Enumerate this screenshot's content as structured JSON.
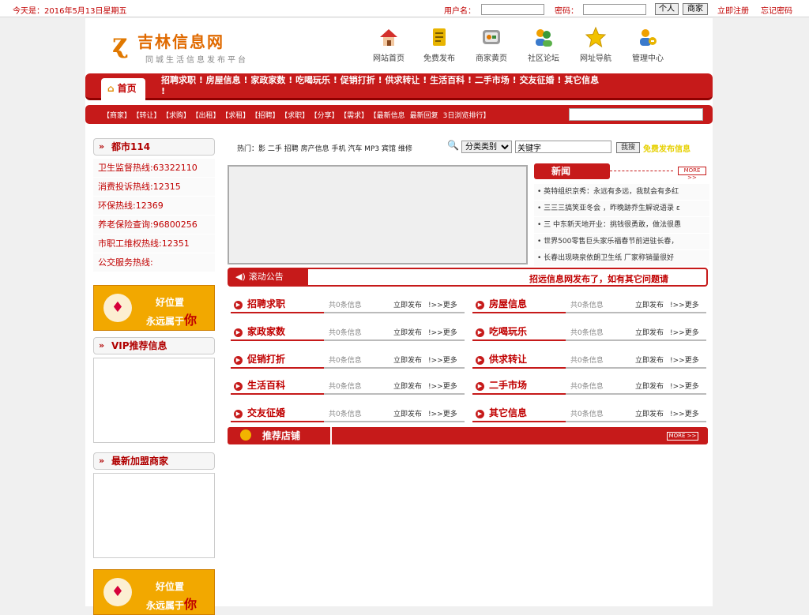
{
  "topbar": {
    "date": "今天是：2016年5月13日星期五",
    "username_label": "用户名：",
    "password_label": "密码：",
    "btn_personal": "个人",
    "btn_merchant": "商家",
    "register_link": "立即注册",
    "forgot_link": "忘记密码"
  },
  "logo": {
    "name": "吉林信息网",
    "tagline": "同城生活信息发布平台"
  },
  "nav_icons": [
    {
      "label": "网站首页",
      "icon": "house-icon"
    },
    {
      "label": "免费发布",
      "icon": "document-icon"
    },
    {
      "label": "商家黄页",
      "icon": "yellowpage-icon"
    },
    {
      "label": "社区论坛",
      "icon": "users-icon"
    },
    {
      "label": "网址导航",
      "icon": "star-icon"
    },
    {
      "label": "管理中心",
      "icon": "admin-icon"
    }
  ],
  "menu": {
    "home": "首页",
    "items": [
      "招聘求职",
      "房屋信息",
      "家政家数",
      "吃喝玩乐",
      "促销打折",
      "供求转让",
      "生活百科",
      "二手市场",
      "交友征婚",
      "其它信息"
    ],
    "trailer": "!"
  },
  "subnav": {
    "links": [
      "【商家】",
      "【转让】",
      "【求购】",
      "【出租】",
      "【求租】",
      "【招聘】",
      "【求职】",
      "【分享】",
      "【需求】",
      "【最新信息",
      "最新回复",
      "3日浏览排行】"
    ]
  },
  "left": {
    "city114_title": "都市114",
    "hotlines": [
      "卫生监督热线:63322110",
      "消费投诉热线:12315",
      "环保热线:12369",
      "养老保险查询:96800256",
      "市职工维权热线:12351",
      "公交服务热线:"
    ],
    "ad_line1": "好位置",
    "ad_line2a": "永远属于",
    "ad_line2b": "你",
    "vip_title": "VIP推荐信息",
    "new_merchants_title": "最新加盟商家"
  },
  "search": {
    "hot_label": "热门：",
    "hot_words": "影 二手 招聘 房产信息 手机 汽车 MP3 宾馆 维修",
    "category_selected": "分类类别",
    "keyword_value": "关键字",
    "search_btn": "我搜",
    "free_post": "免费发布信息"
  },
  "news": {
    "title": "新闻",
    "more": "MORE >>",
    "items": [
      "英特组织京秀：永远有多远，我就会有多红",
      "三三三搞笑亚冬会 ，昨晚跡乔生解说语录 ɛ",
      "三 中东新天地开业：挑钱很勇敢，做法很愚",
      "世界500零售巨头家乐福春节前进驻长春，",
      "长春出现晓泉依朗卫生纸 厂家称销量很好"
    ]
  },
  "scroll": {
    "label": "滚动公告",
    "text": "招远信息网发布了，如有其它问题请"
  },
  "categories": [
    {
      "name": "招聘求职",
      "count": "共0条信息",
      "publish": "立即发布",
      "more": "更多"
    },
    {
      "name": "房屋信息",
      "count": "共0条信息",
      "publish": "立即发布",
      "more": "更多"
    },
    {
      "name": "家政家数",
      "count": "共0条信息",
      "publish": "立即发布",
      "more": "更多"
    },
    {
      "name": "吃喝玩乐",
      "count": "共0条信息",
      "publish": "立即发布",
      "more": "更多"
    },
    {
      "name": "促销打折",
      "count": "共0条信息",
      "publish": "立即发布",
      "more": "更多"
    },
    {
      "name": "供求转让",
      "count": "共0条信息",
      "publish": "立即发布",
      "more": "更多"
    },
    {
      "name": "生活百科",
      "count": "共0条信息",
      "publish": "立即发布",
      "more": "更多"
    },
    {
      "name": "二手市场",
      "count": "共0条信息",
      "publish": "立即发布",
      "more": "更多"
    },
    {
      "name": "交友征婚",
      "count": "共0条信息",
      "publish": "立即发布",
      "more": "更多"
    },
    {
      "name": "其它信息",
      "count": "共0条信息",
      "publish": "立即发布",
      "more": "更多"
    }
  ],
  "shops": {
    "title": "推荐店铺",
    "more": "MORE >>"
  },
  "colors": {
    "brand_red": "#c61a1a",
    "accent_orange": "#e07800",
    "ad_gold": "#f2a800",
    "free_post_yellow": "#e6d000"
  }
}
